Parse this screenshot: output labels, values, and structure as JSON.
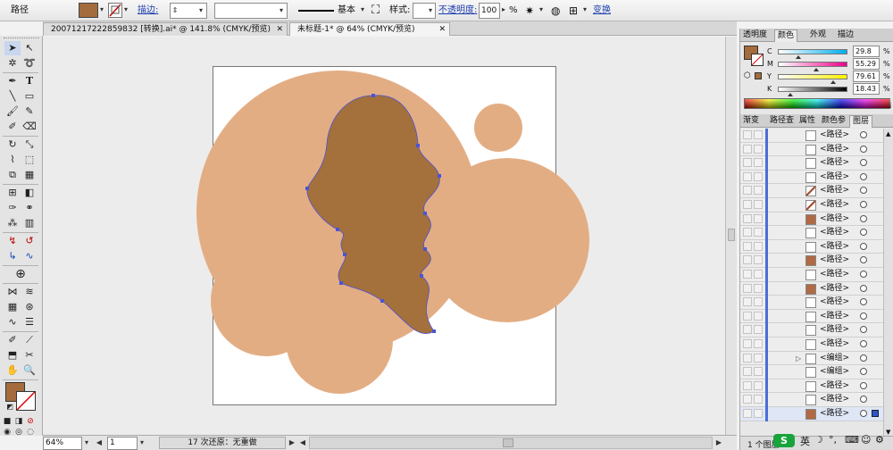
{
  "colors": {
    "fill_swatch": "#a46c3c",
    "big_shape": "#e3ad84",
    "dark_shape": "#a4703b",
    "anchor": "#4a54d8",
    "layer_bar": "#4a6ed6"
  },
  "control_bar": {
    "mode_label": "路径",
    "stroke_link": "描边:",
    "stroke_style_label": "基本",
    "style_label": "样式:",
    "opacity_link": "不透明度:",
    "opacity_value": "100",
    "opacity_unit": "%",
    "transform_link": "变换"
  },
  "tabs": [
    {
      "label": "20071217222859832 [转换].ai* @ 141.8% (CMYK/预览)",
      "close": "✕"
    },
    {
      "label": "未标题-1* @ 64% (CMYK/预览)",
      "close": "✕"
    }
  ],
  "panels": {
    "top_tabs": [
      "透明度",
      "颜色",
      "外观",
      "描边"
    ],
    "color": {
      "channels": [
        {
          "key": "C",
          "value": "29.8",
          "fraction": 0.298
        },
        {
          "key": "M",
          "value": "55.29",
          "fraction": 0.5529
        },
        {
          "key": "Y",
          "value": "79.61",
          "fraction": 0.7961
        },
        {
          "key": "K",
          "value": "18.43",
          "fraction": 0.1843
        }
      ],
      "unit": "%"
    },
    "bottom_tabs": [
      "渐变",
      "路径查",
      "属性",
      "颜色参",
      "图层"
    ]
  },
  "layers": {
    "rows": [
      {
        "name": "<路径>",
        "thumb": "plain"
      },
      {
        "name": "<路径>",
        "thumb": "plain"
      },
      {
        "name": "<路径>",
        "thumb": "plain"
      },
      {
        "name": "<路径>",
        "thumb": "plain"
      },
      {
        "name": "<路径>",
        "thumb": "stroke"
      },
      {
        "name": "<路径>",
        "thumb": "stroke"
      },
      {
        "name": "<路径>",
        "thumb": "brown"
      },
      {
        "name": "<路径>",
        "thumb": "plain"
      },
      {
        "name": "<路径>",
        "thumb": "plain"
      },
      {
        "name": "<路径>",
        "thumb": "brown"
      },
      {
        "name": "<路径>",
        "thumb": "plain"
      },
      {
        "name": "<路径>",
        "thumb": "brown"
      },
      {
        "name": "<路径>",
        "thumb": "plain"
      },
      {
        "name": "<路径>",
        "thumb": "plain"
      },
      {
        "name": "<路径>",
        "thumb": "plain"
      },
      {
        "name": "<路径>",
        "thumb": "plain"
      },
      {
        "name": "<编组>",
        "thumb": "plain",
        "group": true
      },
      {
        "name": "<编组>",
        "thumb": "plain"
      },
      {
        "name": "<路径>",
        "thumb": "plain"
      },
      {
        "name": "<路径>",
        "thumb": "plain"
      },
      {
        "name": "<路径>",
        "thumb": "brown",
        "selected": true
      }
    ],
    "footer": "1 个图层"
  },
  "status": {
    "zoom": "64%",
    "page": "1",
    "undo": "17 次还原：无重做"
  },
  "ime": {
    "brand": "S",
    "lang": "英"
  }
}
